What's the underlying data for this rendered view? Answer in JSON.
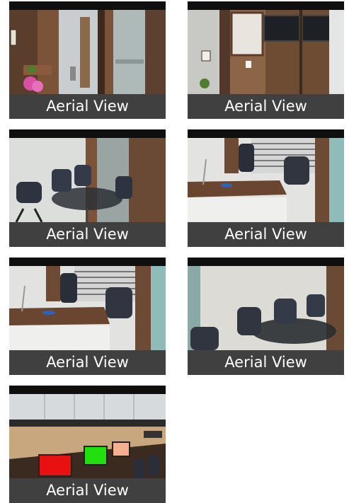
{
  "gallery": {
    "tiles": [
      {
        "caption": "Aerial View",
        "scene": "reception-glass-door"
      },
      {
        "caption": "Aerial View",
        "scene": "wall-mounted-tv-screens"
      },
      {
        "caption": "Aerial View",
        "scene": "meeting-room-chairs"
      },
      {
        "caption": "Aerial View",
        "scene": "cabin-desk"
      },
      {
        "caption": "Aerial View",
        "scene": "cabin-desk-closeup"
      },
      {
        "caption": "Aerial View",
        "scene": "conference-table"
      },
      {
        "caption": "Aerial View",
        "scene": "workstations-monitors"
      }
    ]
  }
}
